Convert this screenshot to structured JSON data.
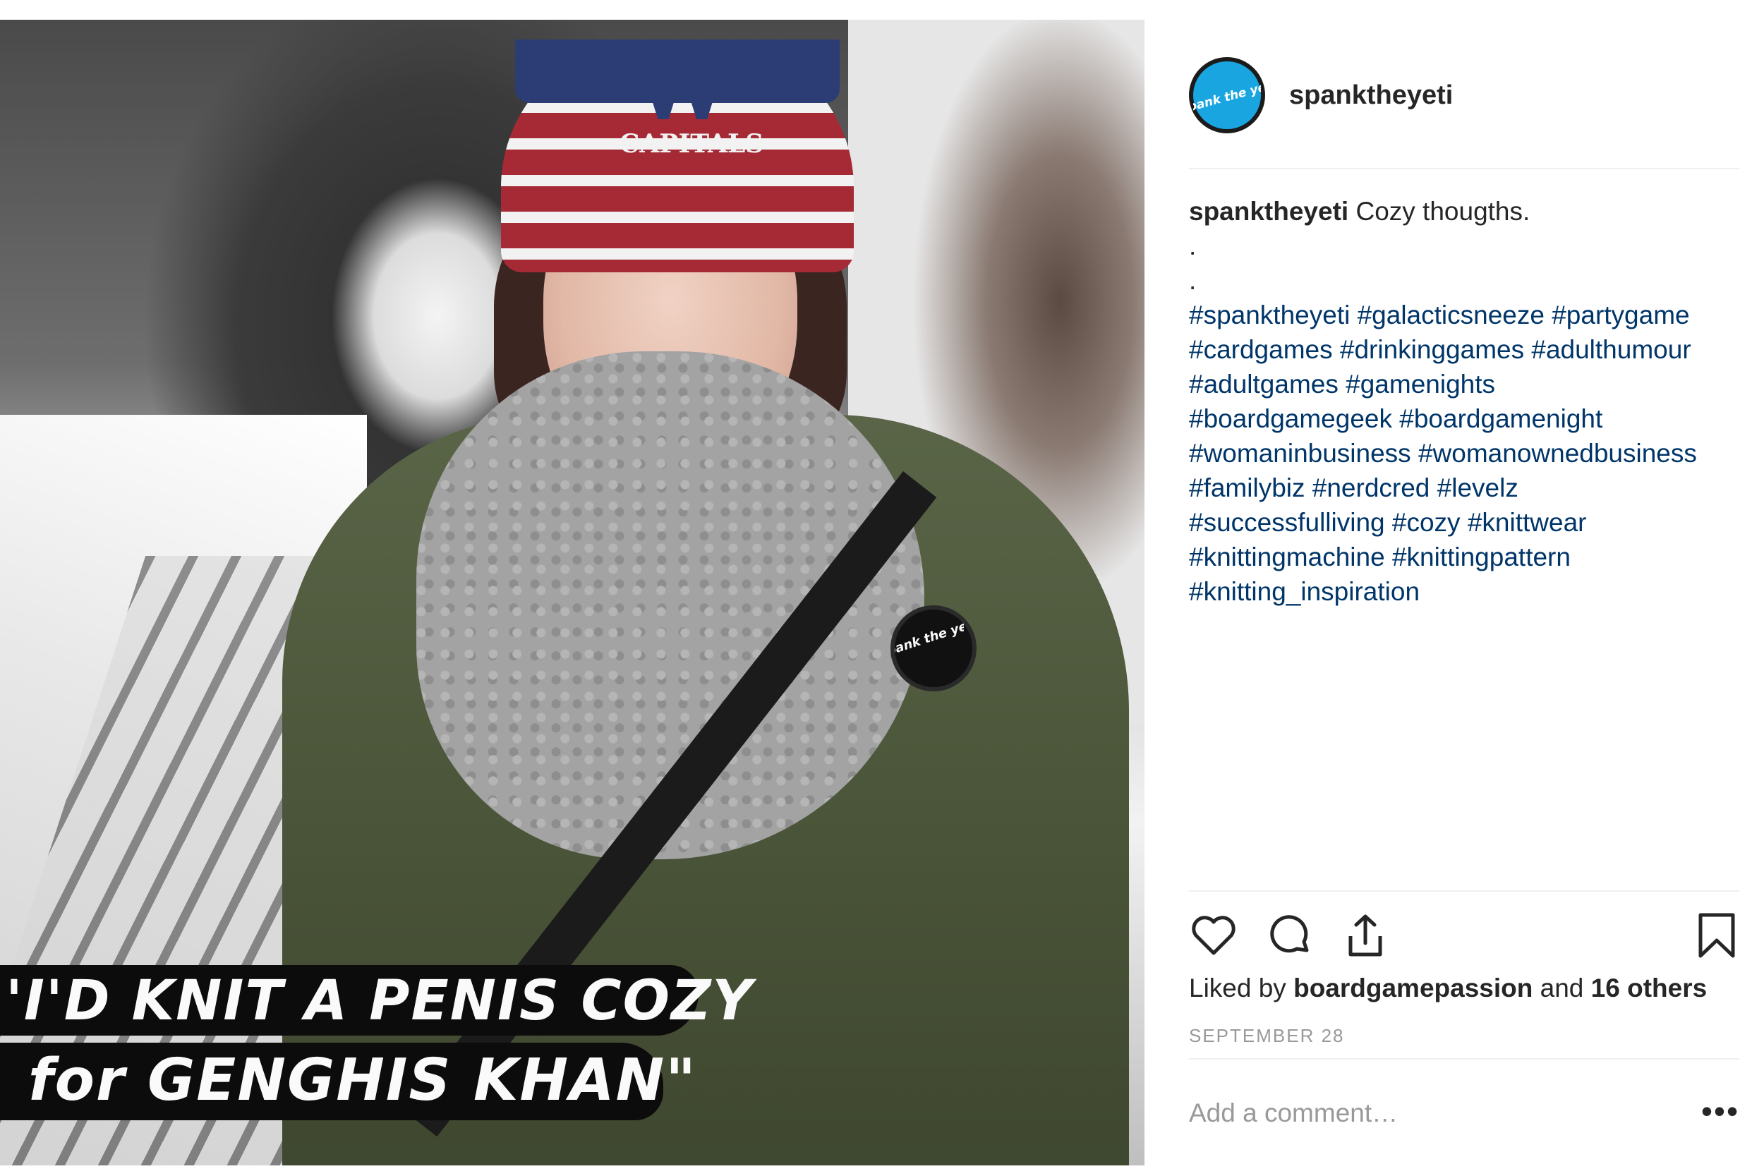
{
  "post": {
    "username": "spanktheyeti",
    "avatar_text": "Spank the yeti",
    "image": {
      "overlay_line1": "'I'D KNIT A PENIS COZY",
      "overlay_line2": "for GENGHIS KHAN\"",
      "hat_text": "CAPITALS",
      "pin_text": "Spank the yeti"
    },
    "caption": {
      "author": "spanktheyeti",
      "text": "Cozy thougths.",
      "dot1": ".",
      "dot2": ".",
      "hashtags": [
        "#spanktheyeti #galacticsneeze #partygame",
        "#cardgames #drinkinggames #adulthumour",
        "#adultgames #gamenights",
        "#boardgamegeek #boardgamenight",
        "#womaninbusiness #womanownedbusiness",
        "#familybiz #nerdcred #levelz",
        "#successfulliving #cozy #knittwear",
        "#knittingmachine #knittingpattern",
        "#knitting_inspiration"
      ]
    },
    "actions": {
      "like_icon": "heart-icon",
      "comment_icon": "speech-bubble-icon",
      "share_icon": "share-icon",
      "save_icon": "bookmark-icon"
    },
    "likes": {
      "prefix": "Liked by",
      "user": "boardgamepassion",
      "and": "and",
      "others": "16 others"
    },
    "date": "SEPTEMBER 28",
    "comment": {
      "placeholder": "Add a comment…",
      "more_label": "•••"
    }
  },
  "colors": {
    "hashtag": "#003569",
    "text": "#262626",
    "muted": "#999999",
    "avatar_bg": "#19a5e0"
  }
}
